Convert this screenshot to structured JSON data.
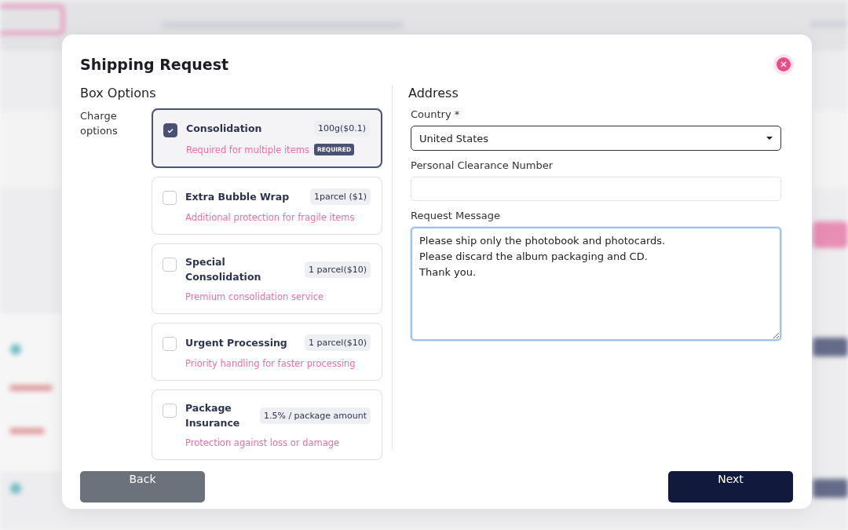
{
  "modal": {
    "title": "Shipping Request"
  },
  "box_options": {
    "heading": "Box Options",
    "label": "Charge options",
    "options": [
      {
        "name": "Consolidation",
        "price": "100g($0.1)",
        "description": "Required for multiple items",
        "badge": "REQUIRED",
        "checked": true
      },
      {
        "name": "Extra Bubble Wrap",
        "price": "1parcel ($1)",
        "description": "Additional protection for fragile items",
        "checked": false
      },
      {
        "name": "Special Consolidation",
        "price": "1 parcel($10)",
        "description": "Premium consolidation service",
        "checked": false
      },
      {
        "name": "Urgent Processing",
        "price": "1 parcel($10)",
        "description": "Priority handling for faster processing",
        "checked": false
      },
      {
        "name": "Package Insurance",
        "price": "1.5% / package amount",
        "description": "Protection against loss or damage",
        "checked": false
      }
    ]
  },
  "address": {
    "heading": "Address",
    "fields": [
      {
        "kind": "select",
        "label": "Country *",
        "value": "United States",
        "focused": false
      },
      {
        "kind": "text",
        "label": "Personal Clearance Number",
        "focused": false
      },
      {
        "kind": "textarea",
        "label": "Request Message",
        "value": "Please ship only the photobook and photocards.\nPlease discard the album packaging and CD.\nThank you.",
        "focused": true
      }
    ]
  },
  "buttons": [
    {
      "label": "Back",
      "kind": "secondary"
    },
    {
      "label": "Next",
      "kind": "primary"
    }
  ]
}
